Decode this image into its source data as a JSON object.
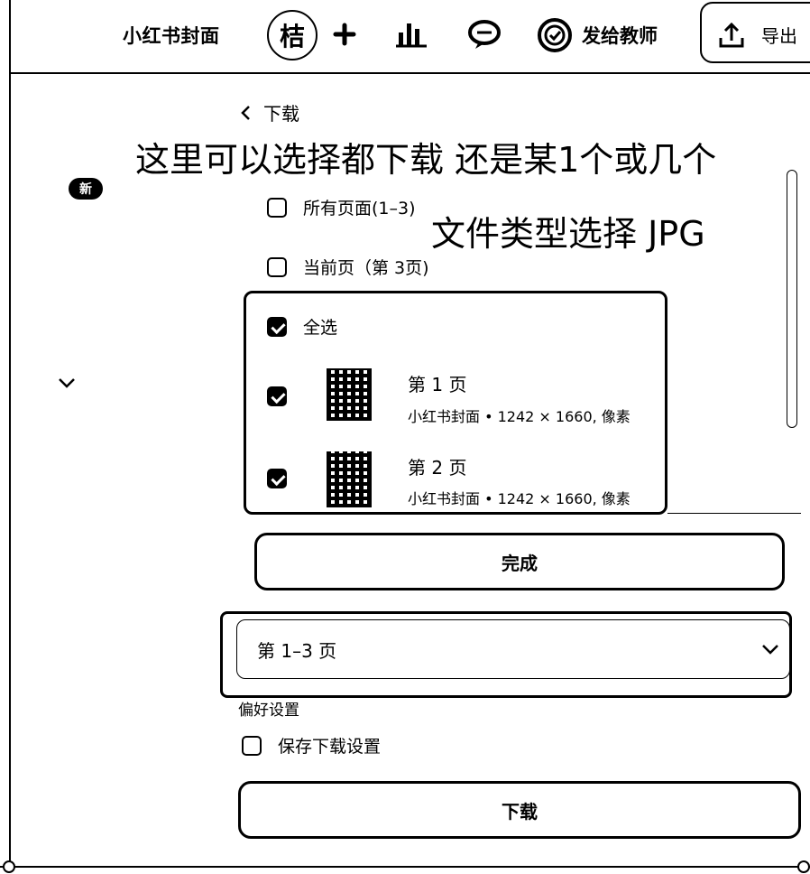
{
  "topbar": {
    "doc_title": "小红书封面",
    "avatar_initial": "桔",
    "add_icon": "plus-icon",
    "chart_icon": "bar-chart-icon",
    "comment_icon": "speech-bubble-icon",
    "send_to_teacher_icon": "check-circle-icon",
    "send_to_teacher_label": "发给教师",
    "export_icon": "upload-icon",
    "export_label": "导出"
  },
  "sidebar": {
    "new_badge": "新",
    "collapse_icon": "chevron-down-icon"
  },
  "panel": {
    "back_label": "下载",
    "options": {
      "all_pages": "所有页面(1–3)",
      "current_page": "当前页（第 3页)"
    },
    "select_all_label": "全选",
    "pages": [
      {
        "title": "第 1 页",
        "meta": "小红书封面 • 1242 × 1660, 像素",
        "checked": true
      },
      {
        "title": "第 2 页",
        "meta": "小红书封面 • 1242 × 1660, 像素",
        "checked": true
      }
    ],
    "done_label": "完成",
    "page_range_value": "第 1–3 页",
    "preferences_label": "偏好设置",
    "save_settings_label": "保存下载设置",
    "download_label": "下载"
  },
  "annotations": {
    "note_download_choice": "这里可以选择都下载 还是某1个或几个",
    "note_file_type": "文件类型选择  JPG"
  }
}
